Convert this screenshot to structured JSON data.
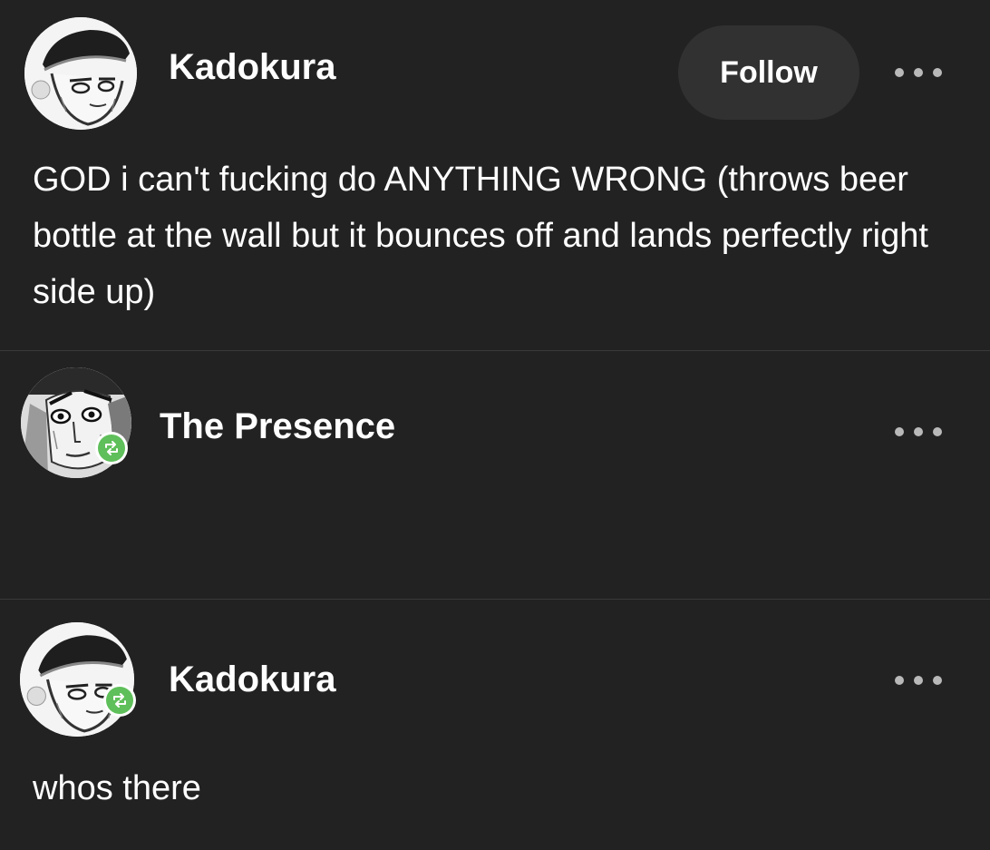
{
  "posts": [
    {
      "username": "Kadokura",
      "follow_label": "Follow",
      "text": "GOD i can't fucking do ANYTHING WRONG (throws beer bottle at the wall but it bounces off and lands perfectly right side up)",
      "avatar_icon": "avatar-kadokura",
      "more_icon": "more-options-icon"
    },
    {
      "username": "The Presence",
      "text": "",
      "avatar_icon": "avatar-the-presence",
      "badge_icon": "reblog-icon",
      "more_icon": "more-options-icon"
    },
    {
      "username": "Kadokura",
      "text": "whos there",
      "avatar_icon": "avatar-kadokura",
      "badge_icon": "reblog-icon",
      "more_icon": "more-options-icon"
    }
  ],
  "colors": {
    "background": "#222222",
    "divider": "#3a3a3a",
    "follow_button": "#313131",
    "reblog_green": "#5fbf5a",
    "text": "#ffffff"
  }
}
